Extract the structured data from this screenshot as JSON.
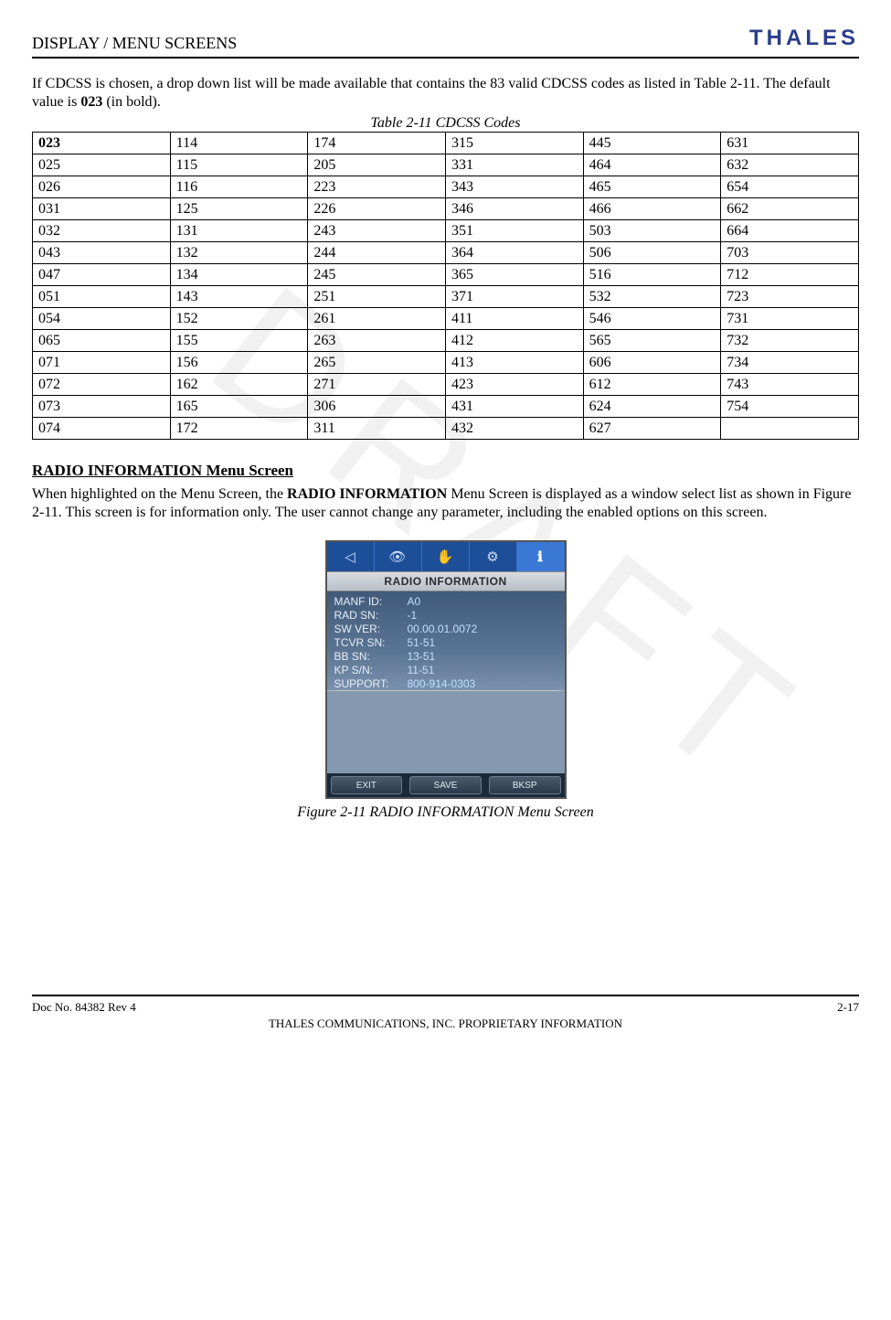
{
  "header": {
    "section": "DISPLAY / MENU SCREENS",
    "brand": "THALES"
  },
  "intro": {
    "line1_a": "If CDCSS is chosen, a drop down list will be made available that contains the 83 valid CDCSS codes as listed in Table 2-11.  The default value is ",
    "line1_bold": "023",
    "line1_b": " (in bold)."
  },
  "table": {
    "caption": "Table 2-11 CDCSS Codes",
    "default_code": "023",
    "rows": [
      [
        "023",
        "114",
        "174",
        "315",
        "445",
        "631"
      ],
      [
        "025",
        "115",
        "205",
        "331",
        "464",
        "632"
      ],
      [
        "026",
        "116",
        "223",
        "343",
        "465",
        "654"
      ],
      [
        "031",
        "125",
        "226",
        "346",
        "466",
        "662"
      ],
      [
        "032",
        "131",
        "243",
        "351",
        "503",
        "664"
      ],
      [
        "043",
        "132",
        "244",
        "364",
        "506",
        "703"
      ],
      [
        "047",
        "134",
        "245",
        "365",
        "516",
        "712"
      ],
      [
        "051",
        "143",
        "251",
        "371",
        "532",
        "723"
      ],
      [
        "054",
        "152",
        "261",
        "411",
        "546",
        "731"
      ],
      [
        "065",
        "155",
        "263",
        "412",
        "565",
        "732"
      ],
      [
        "071",
        "156",
        "265",
        "413",
        "606",
        "734"
      ],
      [
        "072",
        "162",
        "271",
        "423",
        "612",
        "743"
      ],
      [
        "073",
        "165",
        "306",
        "431",
        "624",
        "754"
      ],
      [
        "074",
        "172",
        "311",
        "432",
        "627",
        ""
      ]
    ]
  },
  "section2": {
    "title": "RADIO INFORMATION Menu Screen",
    "para_a": "When highlighted on the Menu Screen, the ",
    "para_bold": "RADIO INFORMATION",
    "para_b": " Menu Screen is displayed as a window select list as shown in Figure 2-11.  This screen is for information only.  The user cannot change any parameter, including the enabled options on this screen."
  },
  "device": {
    "tabs": [
      "◁",
      "👁",
      "✋",
      "⚙",
      "ℹ"
    ],
    "heading": "RADIO INFORMATION",
    "info": [
      {
        "label": "MANF ID:",
        "value": "A0"
      },
      {
        "label": "RAD SN:",
        "value": "-1"
      },
      {
        "label": "SW VER:",
        "value": "00.00.01.0072"
      },
      {
        "label": "TCVR SN:",
        "value": "51-51"
      },
      {
        "label": "BB SN:",
        "value": "13-51"
      },
      {
        "label": "KP S/N:",
        "value": "11-51"
      },
      {
        "label": "SUPPORT:",
        "value": "800-914-0303"
      }
    ],
    "softkeys": [
      "EXIT",
      "SAVE",
      "BKSP"
    ]
  },
  "figure_caption": "Figure 2-11 RADIO INFORMATION Menu Screen",
  "footer": {
    "doc": "Doc No. 84382 Rev 4",
    "page": "2-17",
    "proprietary": "THALES COMMUNICATIONS, INC. PROPRIETARY INFORMATION"
  },
  "watermark": "DRAFT"
}
